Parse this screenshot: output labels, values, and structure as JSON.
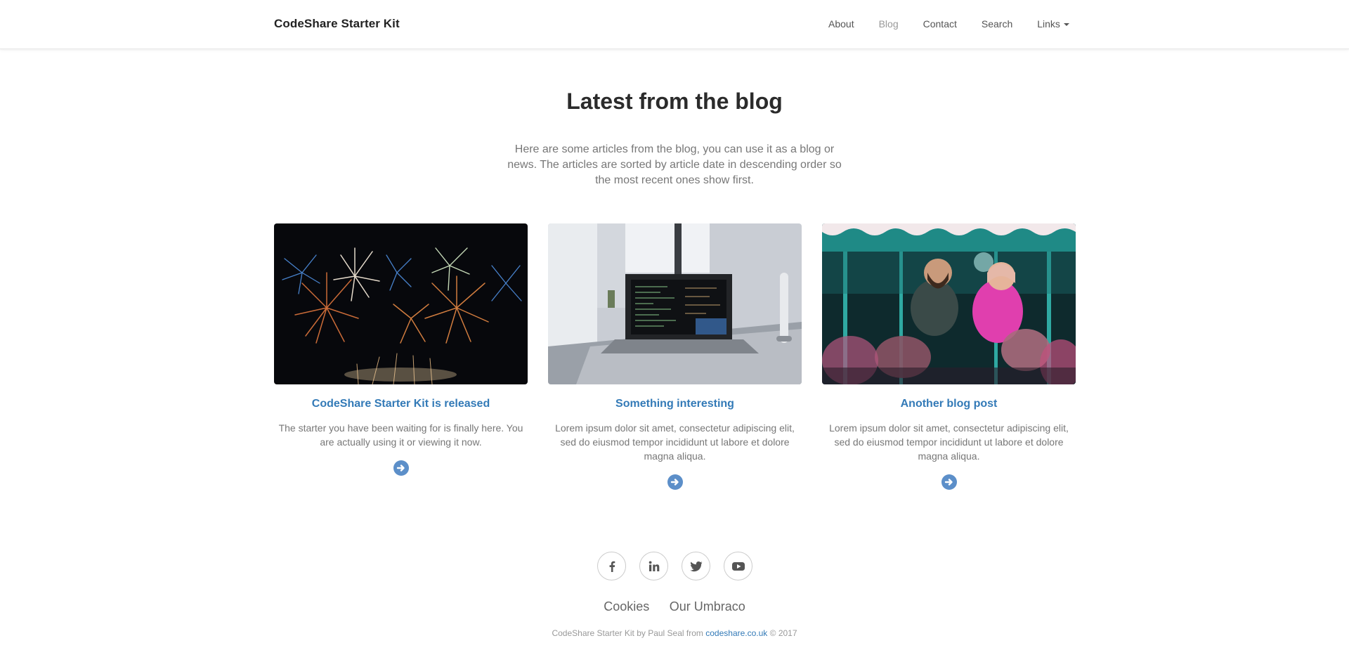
{
  "header": {
    "brand": "CodeShare Starter Kit",
    "nav": [
      {
        "label": "About",
        "active": false
      },
      {
        "label": "Blog",
        "active": true
      },
      {
        "label": "Contact",
        "active": false
      },
      {
        "label": "Search",
        "active": false
      },
      {
        "label": "Links",
        "active": false,
        "has_dropdown": true
      }
    ]
  },
  "main": {
    "title": "Latest from the blog",
    "intro": "Here are some articles from the blog, you can use it as a blog or news. The articles are sorted by article date in descending order so the most recent ones show first.",
    "articles": [
      {
        "title": "CodeShare Starter Kit is released",
        "summary": "The starter you have been waiting for is finally here. You are actually using it or viewing it now.",
        "image": "fireworks-photo",
        "more_icon": "arrow-circle-right-icon"
      },
      {
        "title": "Something interesting",
        "summary": "Lorem ipsum dolor sit amet, consectetur adipiscing elit, sed do eiusmod tempor incididunt ut labore et dolore magna aliqua.",
        "image": "laptop-desk-photo",
        "more_icon": "arrow-circle-right-icon"
      },
      {
        "title": "Another blog post",
        "summary": "Lorem ipsum dolor sit amet, consectetur adipiscing elit, sed do eiusmod tempor incididunt ut labore et dolore magna aliqua.",
        "image": "carousel-photo",
        "more_icon": "arrow-circle-right-icon"
      }
    ]
  },
  "footer": {
    "social": [
      "facebook-icon",
      "linkedin-icon",
      "twitter-icon",
      "youtube-icon"
    ],
    "links": [
      "Cookies",
      "Our Umbraco"
    ],
    "copyright_prefix": "CodeShare Starter Kit by Paul Seal from ",
    "copyright_link": "codeshare.co.uk",
    "copyright_suffix": " © 2017"
  },
  "colors": {
    "link": "#337ab7",
    "muted_text": "#777777",
    "arrow_button": "#5c8fc9"
  }
}
